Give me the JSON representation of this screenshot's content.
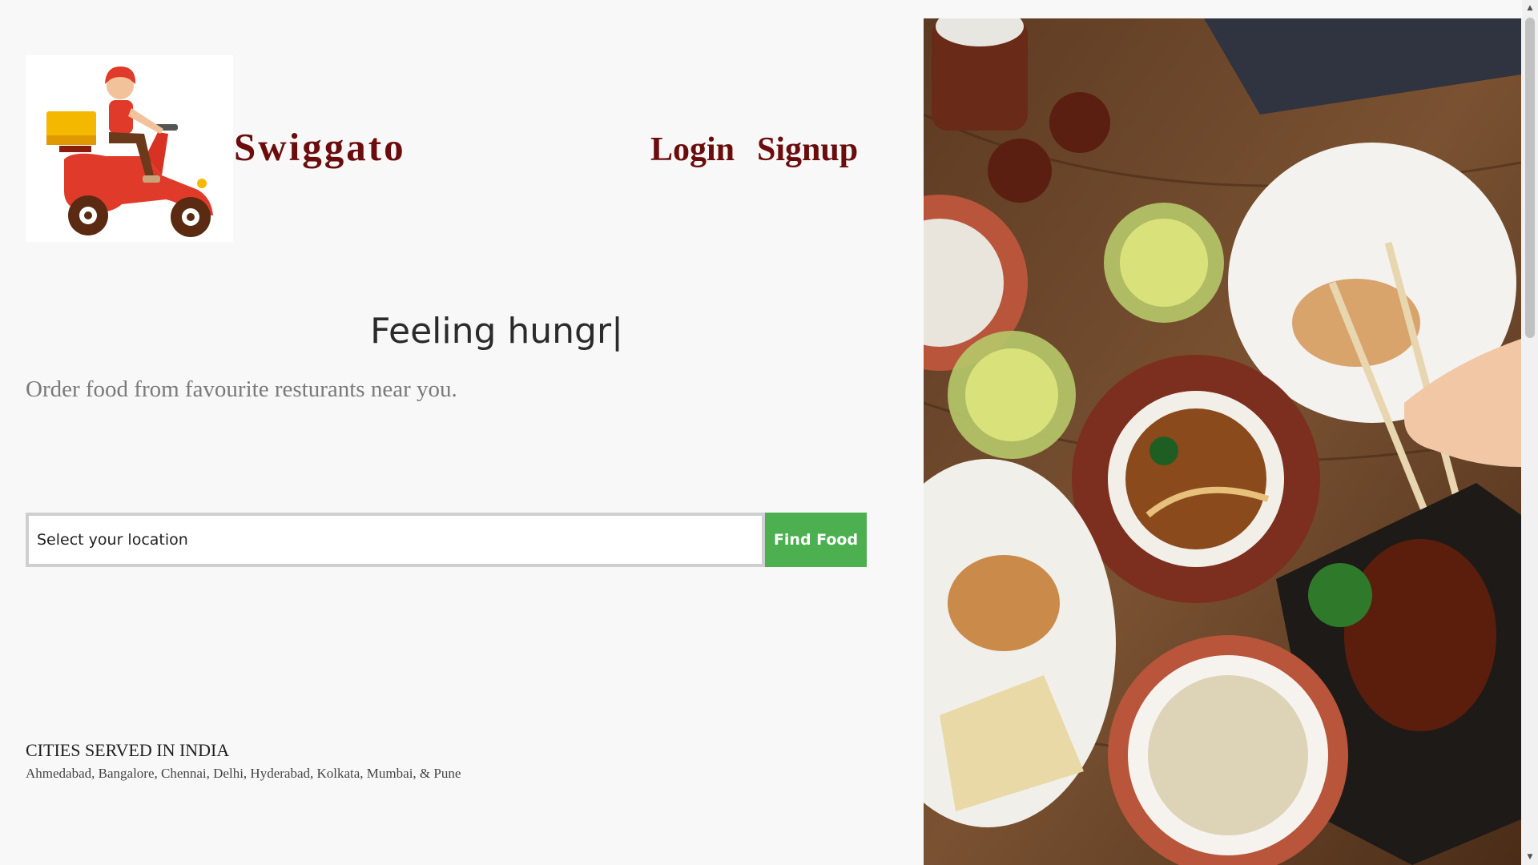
{
  "header": {
    "brand": "Swiggato",
    "nav": {
      "login": "Login",
      "signup": "Signup"
    }
  },
  "logo_icon": "delivery-scooter-icon",
  "hero": {
    "headline": "Feeling hungr|",
    "subline": "Order food from favourite resturants near you."
  },
  "search": {
    "placeholder": "Select your location",
    "button": "Find Food",
    "button_color": "#4caf50"
  },
  "cities": {
    "title": "CITIES SERVED IN INDIA",
    "list": "Ahmedabad, Bangalore, Chennai, Delhi, Hyderabad, Kolkata, Mumbai, & Pune"
  },
  "hero_image_icon": "food-table-photo",
  "colors": {
    "brand": "#6b0d0d",
    "background": "#f8f8f8"
  }
}
